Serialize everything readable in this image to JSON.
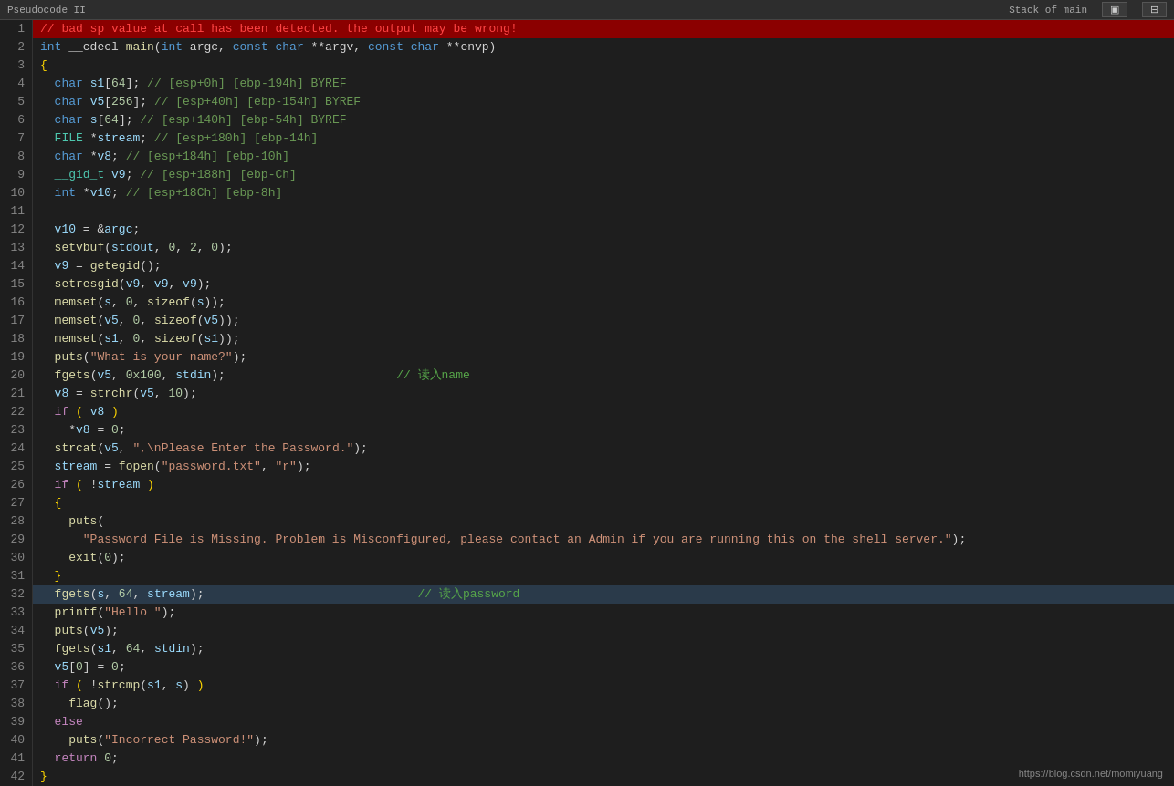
{
  "topbar": {
    "left_text": "Pseudocode II",
    "stack_label": "Stack of main",
    "btn1_label": "",
    "btn2_label": ""
  },
  "lines": [
    {
      "num": 1,
      "type": "error",
      "content": "// bad sp value at call has been detected. the output may be wrong!"
    },
    {
      "num": 2,
      "type": "normal"
    },
    {
      "num": 3,
      "type": "normal"
    },
    {
      "num": 4,
      "type": "normal"
    },
    {
      "num": 5,
      "type": "normal"
    },
    {
      "num": 6,
      "type": "normal"
    },
    {
      "num": 7,
      "type": "normal"
    },
    {
      "num": 8,
      "type": "normal"
    },
    {
      "num": 9,
      "type": "normal"
    },
    {
      "num": 10,
      "type": "normal"
    },
    {
      "num": 11,
      "type": "normal"
    },
    {
      "num": 12,
      "type": "normal"
    },
    {
      "num": 13,
      "type": "normal"
    },
    {
      "num": 14,
      "type": "normal"
    },
    {
      "num": 15,
      "type": "normal"
    },
    {
      "num": 16,
      "type": "normal"
    },
    {
      "num": 17,
      "type": "normal"
    },
    {
      "num": 18,
      "type": "normal"
    },
    {
      "num": 19,
      "type": "normal"
    },
    {
      "num": 20,
      "type": "normal"
    },
    {
      "num": 21,
      "type": "normal"
    },
    {
      "num": 22,
      "type": "normal"
    },
    {
      "num": 23,
      "type": "normal"
    },
    {
      "num": 24,
      "type": "normal"
    },
    {
      "num": 25,
      "type": "normal"
    },
    {
      "num": 26,
      "type": "normal"
    },
    {
      "num": 27,
      "type": "normal"
    },
    {
      "num": 28,
      "type": "normal"
    },
    {
      "num": 29,
      "type": "normal"
    },
    {
      "num": 30,
      "type": "normal"
    },
    {
      "num": 31,
      "type": "normal"
    },
    {
      "num": 32,
      "type": "highlight"
    },
    {
      "num": 33,
      "type": "normal"
    },
    {
      "num": 34,
      "type": "normal"
    },
    {
      "num": 35,
      "type": "normal"
    },
    {
      "num": 36,
      "type": "normal"
    },
    {
      "num": 37,
      "type": "normal"
    },
    {
      "num": 38,
      "type": "normal"
    },
    {
      "num": 39,
      "type": "normal"
    },
    {
      "num": 40,
      "type": "normal"
    },
    {
      "num": 41,
      "type": "normal"
    },
    {
      "num": 42,
      "type": "normal"
    }
  ],
  "watermark": "https://blog.csdn.net/momiyuang"
}
